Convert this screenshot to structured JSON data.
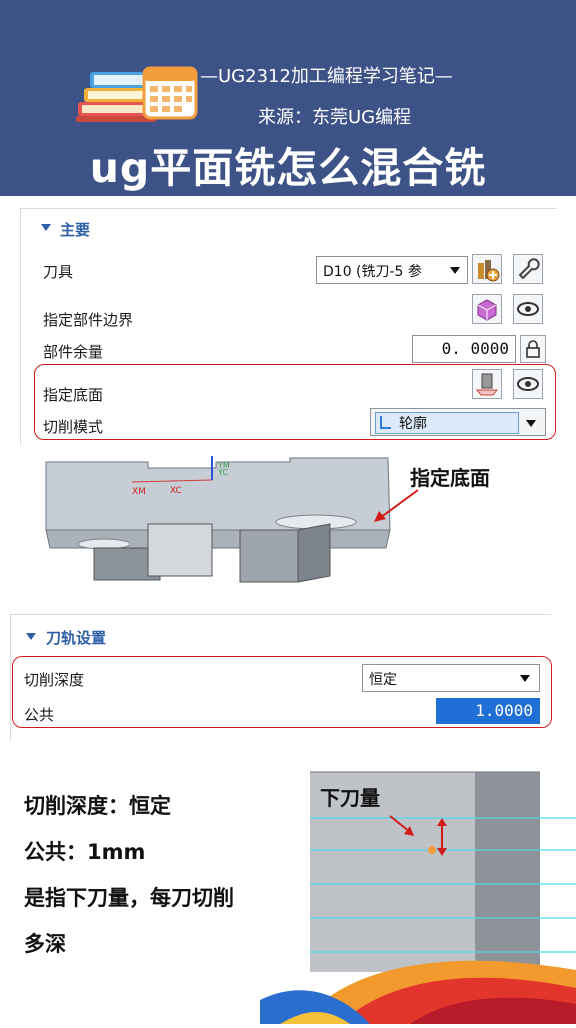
{
  "header": {
    "series": "—UG2312加工编程学习笔记—",
    "source": "来源：东莞UG编程",
    "title": "ug平面铣怎么混合铣"
  },
  "panel_main": {
    "section_title": "主要",
    "tool_label": "刀具",
    "tool_value": "D10 (铣刀-5 参",
    "part_boundary_label": "指定部件边界",
    "part_stock_label": "部件余量",
    "part_stock_value": "0. 0000",
    "floor_label": "指定底面",
    "cut_mode_label": "切削模式",
    "cut_mode_value": "轮廓"
  },
  "model": {
    "annotation": "指定底面",
    "axis_xm": "XM",
    "axis_xc": "XC",
    "axis_ym": "YM",
    "axis_yc": "YC"
  },
  "panel_path": {
    "section_title": "刀轨设置",
    "depth_label": "切削深度",
    "depth_value": "恒定",
    "common_label": "公共",
    "common_value": "1.0000"
  },
  "notes": {
    "line1": "切削深度：恒定",
    "line2": "公共：1mm",
    "line3": "是指下刀量，每刀切削",
    "line4": "多深",
    "step_label": "下刀量"
  },
  "colors": {
    "header_bg": "#3d5287",
    "accent_red": "#d11c1c",
    "section_blue": "#2c5fa6",
    "selected_blue": "#1f6fd6"
  }
}
